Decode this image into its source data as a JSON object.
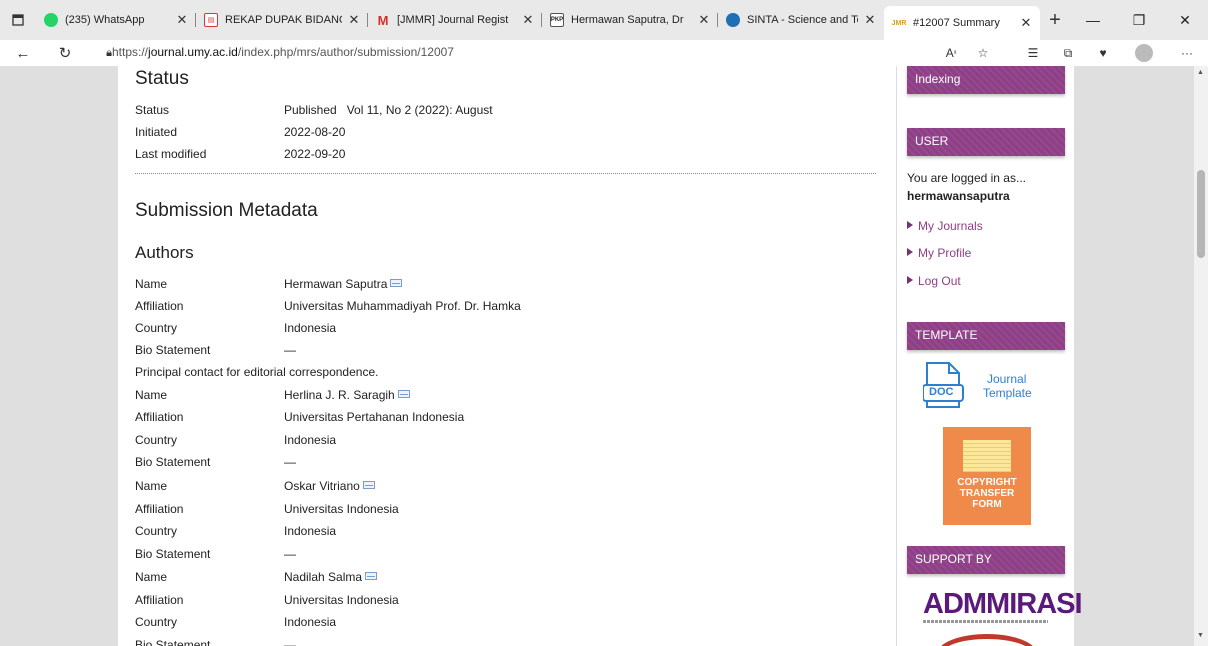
{
  "tabs": [
    {
      "title": "(235) WhatsApp",
      "icon": "whatsapp-icon"
    },
    {
      "title": "REKAP DUPAK BIDANG",
      "icon": "pdf-icon"
    },
    {
      "title": "[JMMR] Journal Regist",
      "icon": "gmail-icon"
    },
    {
      "title": "Hermawan Saputra, Dr",
      "icon": "pkp-icon",
      "fav_text": "PKP"
    },
    {
      "title": "SINTA - Science and Te",
      "icon": "sinta-icon"
    },
    {
      "title": "#12007 Summary",
      "icon": "jmmr-icon",
      "fav_text": "JMR",
      "active": true
    }
  ],
  "address": {
    "prefix": "https://",
    "host": "journal.umy.ac.id",
    "path": "/index.php/mrs/author/submission/12007"
  },
  "status": {
    "heading": "Status",
    "rows": [
      {
        "label": "Status",
        "value": "Published   Vol 11, No 2 (2022): August"
      },
      {
        "label": "Initiated",
        "value": "2022-08-20"
      },
      {
        "label": "Last modified",
        "value": "2022-09-20"
      }
    ]
  },
  "metadata": {
    "heading": "Submission Metadata",
    "authors_heading": "Authors",
    "principal_note": "Principal contact for editorial correspondence.",
    "authors": [
      {
        "name": "Hermawan Saputra",
        "affiliation": "Universitas Muhammadiyah Prof. Dr. Hamka",
        "country": "Indonesia",
        "bio": "—"
      },
      {
        "name": "Herlina J. R. Saragih",
        "affiliation": "Universitas Pertahanan Indonesia",
        "country": "Indonesia",
        "bio": "—"
      },
      {
        "name": "Oskar Vitriano",
        "affiliation": "Universitas Indonesia",
        "country": "Indonesia",
        "bio": "—"
      },
      {
        "name": "Nadilah Salma",
        "affiliation": "Universitas Indonesia",
        "country": "Indonesia",
        "bio": "—"
      }
    ],
    "labels": {
      "name": "Name",
      "affiliation": "Affiliation",
      "country": "Country",
      "bio": "Bio Statement"
    }
  },
  "sidebar": {
    "indexing": "Indexing",
    "user_title": "USER",
    "logged_in": "You are logged in as...",
    "username": "hermawansaputra",
    "links": [
      "My Journals",
      "My Profile",
      "Log Out"
    ],
    "template_title": "TEMPLATE",
    "doc_label": "DOC",
    "doc_text_1": "Journal",
    "doc_text_2": "Template",
    "ctf_1": "COPYRIGHT",
    "ctf_2": "TRANSFER",
    "ctf_3": "FORM",
    "support_title": "SUPPORT BY",
    "admm": "ADMMIRASI"
  },
  "colors": {
    "accent": "#8e3f86",
    "link": "#8e3f86",
    "ctf": "#f08a4b",
    "doc_blue": "#2f7fd1"
  }
}
